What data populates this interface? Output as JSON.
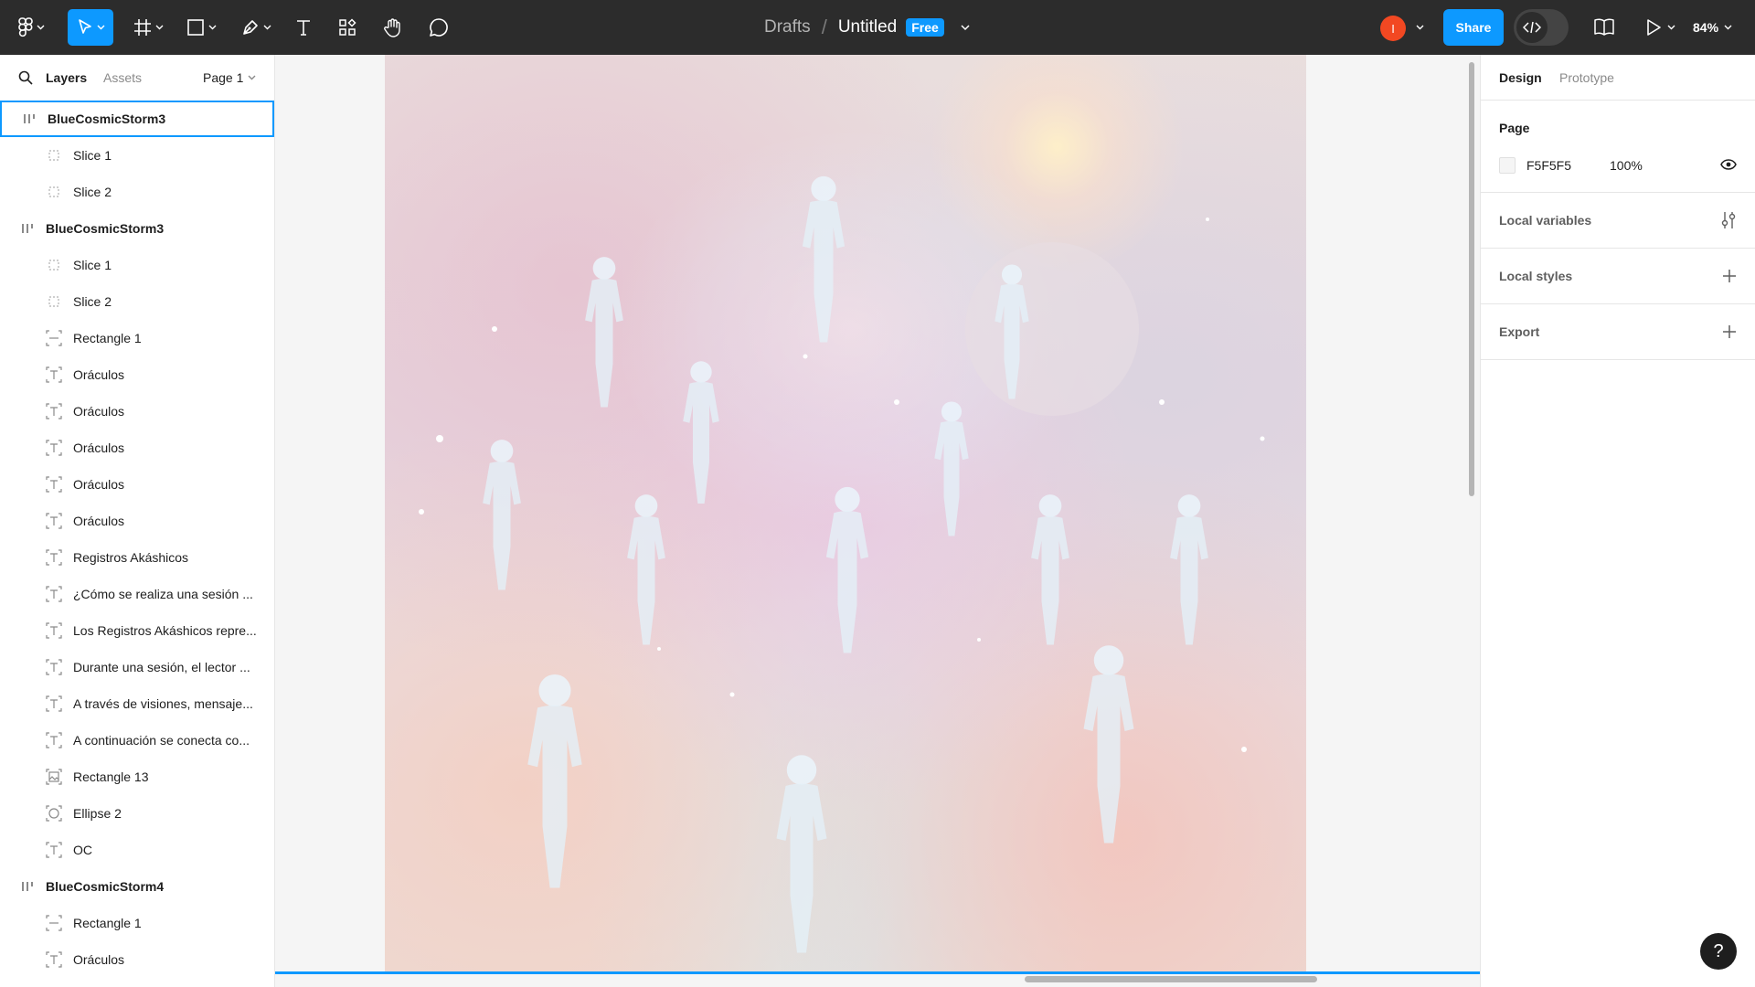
{
  "toolbar": {
    "breadcrumb_parent": "Drafts",
    "breadcrumb_sep": "/",
    "file_title": "Untitled",
    "plan_badge": "Free",
    "avatar_initial": "I",
    "share_label": "Share",
    "zoom_level": "84%",
    "icons": [
      "figma-menu-icon",
      "move-tool-icon",
      "frame-tool-icon",
      "shape-tool-icon",
      "pen-tool-icon",
      "text-tool-icon",
      "resources-icon",
      "hand-tool-icon",
      "comment-icon",
      "dev-mode-icon",
      "library-icon",
      "present-icon"
    ]
  },
  "left_panel": {
    "tab_layers": "Layers",
    "tab_assets": "Assets",
    "page_selector": "Page 1",
    "layers": [
      {
        "label": "BlueCosmicStorm3",
        "kind": "frame",
        "icon": "frame-icon",
        "selected": true
      },
      {
        "label": "Slice 1",
        "kind": "child",
        "icon": "slice-icon"
      },
      {
        "label": "Slice 2",
        "kind": "child",
        "icon": "slice-icon"
      },
      {
        "label": "BlueCosmicStorm3",
        "kind": "frame",
        "icon": "frame-icon"
      },
      {
        "label": "Slice 1",
        "kind": "child",
        "icon": "slice-icon"
      },
      {
        "label": "Slice 2",
        "kind": "child",
        "icon": "slice-icon"
      },
      {
        "label": "Rectangle 1",
        "kind": "child",
        "icon": "rectangle-icon"
      },
      {
        "label": "Oráculos",
        "kind": "child",
        "icon": "text-layer-icon"
      },
      {
        "label": "Oráculos",
        "kind": "child",
        "icon": "text-layer-icon"
      },
      {
        "label": "Oráculos",
        "kind": "child",
        "icon": "text-layer-icon"
      },
      {
        "label": "Oráculos",
        "kind": "child",
        "icon": "text-layer-icon"
      },
      {
        "label": "Oráculos",
        "kind": "child",
        "icon": "text-layer-icon"
      },
      {
        "label": "Registros Akáshicos",
        "kind": "child",
        "icon": "text-layer-icon"
      },
      {
        "label": "¿Cómo se realiza una sesión ...",
        "kind": "child",
        "icon": "text-layer-icon"
      },
      {
        "label": "Los Registros Akáshicos repre...",
        "kind": "child",
        "icon": "text-layer-icon"
      },
      {
        "label": "Durante una sesión, el lector ...",
        "kind": "child",
        "icon": "text-layer-icon"
      },
      {
        "label": "A través de visiones, mensaje...",
        "kind": "child",
        "icon": "text-layer-icon"
      },
      {
        "label": "A continuación se conecta co...",
        "kind": "child",
        "icon": "text-layer-icon"
      },
      {
        "label": "Rectangle 13",
        "kind": "child",
        "icon": "image-icon"
      },
      {
        "label": "Ellipse 2",
        "kind": "child",
        "icon": "ellipse-icon"
      },
      {
        "label": "OC",
        "kind": "child",
        "icon": "text-layer-icon"
      },
      {
        "label": "BlueCosmicStorm4",
        "kind": "frame",
        "icon": "frame-icon"
      },
      {
        "label": "Rectangle 1",
        "kind": "child",
        "icon": "rectangle-icon"
      },
      {
        "label": "Oráculos",
        "kind": "child",
        "icon": "text-layer-icon"
      }
    ]
  },
  "right_panel": {
    "tab_design": "Design",
    "tab_prototype": "Prototype",
    "page_heading": "Page",
    "page_color_hex": "F5F5F5",
    "page_opacity": "100%",
    "local_variables": "Local variables",
    "local_styles": "Local styles",
    "export": "Export"
  },
  "help_label": "?",
  "colors": {
    "toolbar_bg": "#2c2c2c",
    "accent": "#0d99ff",
    "avatar": "#f24822",
    "canvas_bg": "#f5f5f5"
  }
}
